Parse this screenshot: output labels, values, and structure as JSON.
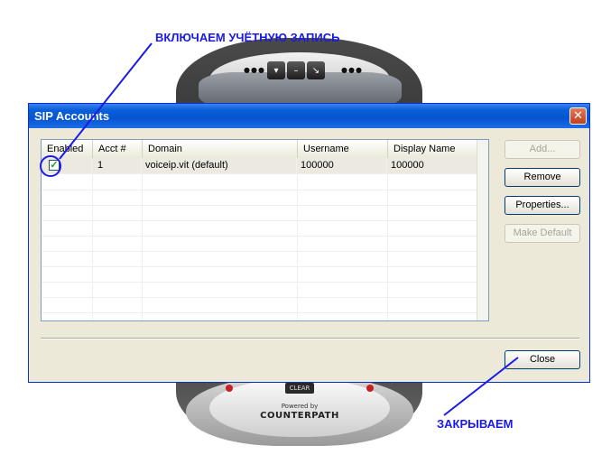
{
  "annotations": {
    "top_label": "ВКЛЮЧАЕМ УЧЁТНУЮ ЗАПИСЬ",
    "bottom_label": "ЗАКРЫВАЕМ",
    "color": "#1a1ae6"
  },
  "phone": {
    "clear_label": "CLEAR",
    "powered_by": "Powered by",
    "brand": "COUNTERPATH"
  },
  "dialog": {
    "title": "SIP Accounts",
    "close_glyph": "✕"
  },
  "table": {
    "columns": [
      "Enabled",
      "Acct #",
      "Domain",
      "Username",
      "Display Name"
    ],
    "rows": [
      {
        "enabled": true,
        "acct": "1",
        "domain": "voiceip.vit (default)",
        "username": "100000",
        "display_name": "100000"
      }
    ]
  },
  "buttons": {
    "add": "Add...",
    "remove": "Remove",
    "properties": "Properties...",
    "make_default": "Make Default",
    "close": "Close"
  }
}
